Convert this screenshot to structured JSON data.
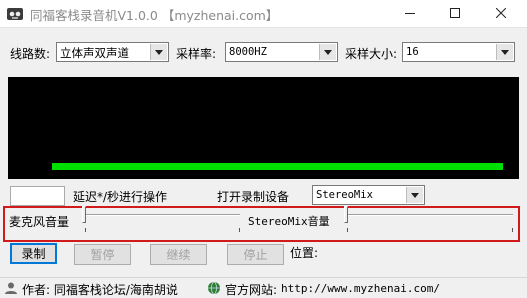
{
  "window": {
    "title": "同福客栈录音机V1.0.0 【myzhenai.com】"
  },
  "controls": {
    "channel_label": "线路数:",
    "channel_value": "立体声双声道",
    "samplerate_label": "采样率:",
    "samplerate_value": "8000HZ",
    "samplesize_label": "采样大小:",
    "samplesize_value": "16"
  },
  "delay": {
    "input_value": "",
    "label": "延迟*/秒进行操作"
  },
  "device": {
    "label": "打开录制设备",
    "value": "StereoMix"
  },
  "sliders": {
    "mic_label": "麦克风音量",
    "mic_level": 0.0,
    "stereomix_label": "StereoMix音量",
    "stereomix_level": 0.0
  },
  "meter": {
    "level": 0.93,
    "color": "#00e000"
  },
  "buttons": {
    "record": "录制",
    "pause": "暂停",
    "resume": "继续",
    "stop": "停止"
  },
  "position_label": "位置:",
  "statusbar": {
    "author": "作者: 同福客栈论坛/海南胡说",
    "website_label": "官方网站:",
    "website_url": "http://www.myzhenai.com/"
  },
  "icons": {
    "app": "cassette-recorder-icon",
    "minimize": "minimize-icon",
    "maximize": "maximize-icon",
    "close": "close-icon",
    "author": "person-icon",
    "website": "globe-icon"
  },
  "colors": {
    "highlight_frame": "#d11b1b",
    "monitor_bg": "#000000",
    "default_button_border": "#0078d7"
  }
}
